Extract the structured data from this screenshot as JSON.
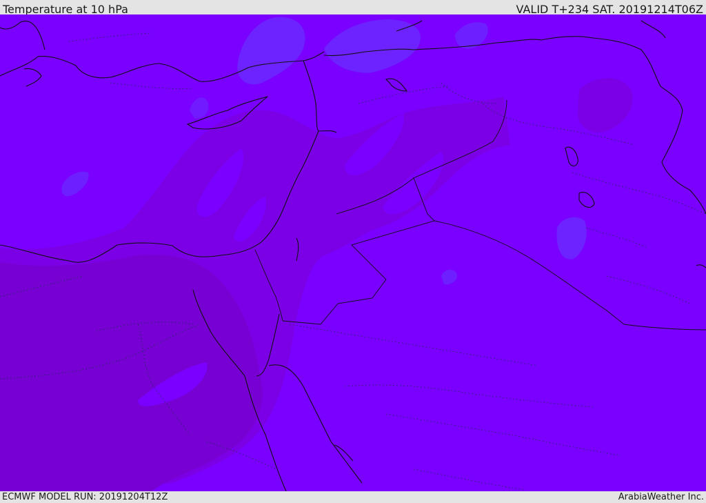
{
  "header": {
    "title": "Temperature at 10 hPa",
    "valid": "VALID T+234 SAT. 20191214T06Z"
  },
  "footer": {
    "model_run": "ECMWF MODEL RUN: 20191204T12Z",
    "credit": "ArabiaWeather Inc."
  },
  "map": {
    "colors": {
      "base": "#7a00ff",
      "warm_band": "#7b00dd",
      "warmest": "#7800cc",
      "cool_patch": "#6a2cff",
      "coast": "#111111",
      "border": "#333366"
    }
  }
}
